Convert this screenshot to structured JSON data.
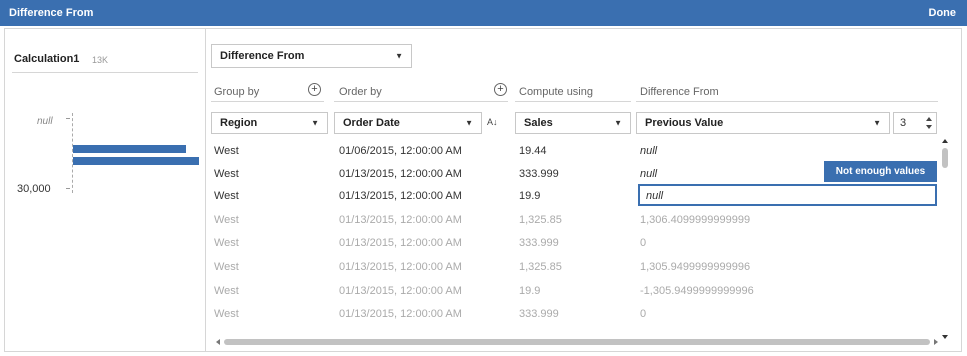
{
  "window": {
    "title": "Difference From",
    "done_label": "Done"
  },
  "sidebar": {
    "calc_name": "Calculation1",
    "calc_count": "13K",
    "hist_null_label": "null",
    "hist_axis_label": "30,000"
  },
  "toolbar": {
    "calc_type": "Difference From"
  },
  "columns": {
    "group_by": {
      "header": "Group by",
      "value": "Region"
    },
    "order_by": {
      "header": "Order by",
      "value": "Order Date"
    },
    "compute_using": {
      "header": "Compute using",
      "value": "Sales"
    },
    "difference_from": {
      "header": "Difference From",
      "value": "Previous Value",
      "step": "3"
    }
  },
  "tooltip": "Not enough values",
  "rows": [
    {
      "region": "West",
      "date": "01/06/2015, 12:00:00 AM",
      "sales": "19.44",
      "diff": "null"
    },
    {
      "region": "West",
      "date": "01/13/2015, 12:00:00 AM",
      "sales": "333.999",
      "diff": "null"
    },
    {
      "region": "West",
      "date": "01/13/2015, 12:00:00 AM",
      "sales": "19.9",
      "diff": "null"
    },
    {
      "region": "West",
      "date": "01/13/2015, 12:00:00 AM",
      "sales": "1,325.85",
      "diff": "1,306.4099999999999"
    },
    {
      "region": "West",
      "date": "01/13/2015, 12:00:00 AM",
      "sales": "333.999",
      "diff": "0"
    },
    {
      "region": "West",
      "date": "01/13/2015, 12:00:00 AM",
      "sales": "1,325.85",
      "diff": "1,305.9499999999996"
    },
    {
      "region": "West",
      "date": "01/13/2015, 12:00:00 AM",
      "sales": "19.9",
      "diff": "-1,305.9499999999996"
    },
    {
      "region": "West",
      "date": "01/13/2015, 12:00:00 AM",
      "sales": "333.999",
      "diff": "0"
    }
  ],
  "colors": {
    "accent": "#3a6fb0",
    "border": "#d6d6d6",
    "dim_text": "#aaaaaa"
  },
  "icons": {
    "sort": "sort-ascending-icon",
    "add": "plus-circle-icon"
  }
}
